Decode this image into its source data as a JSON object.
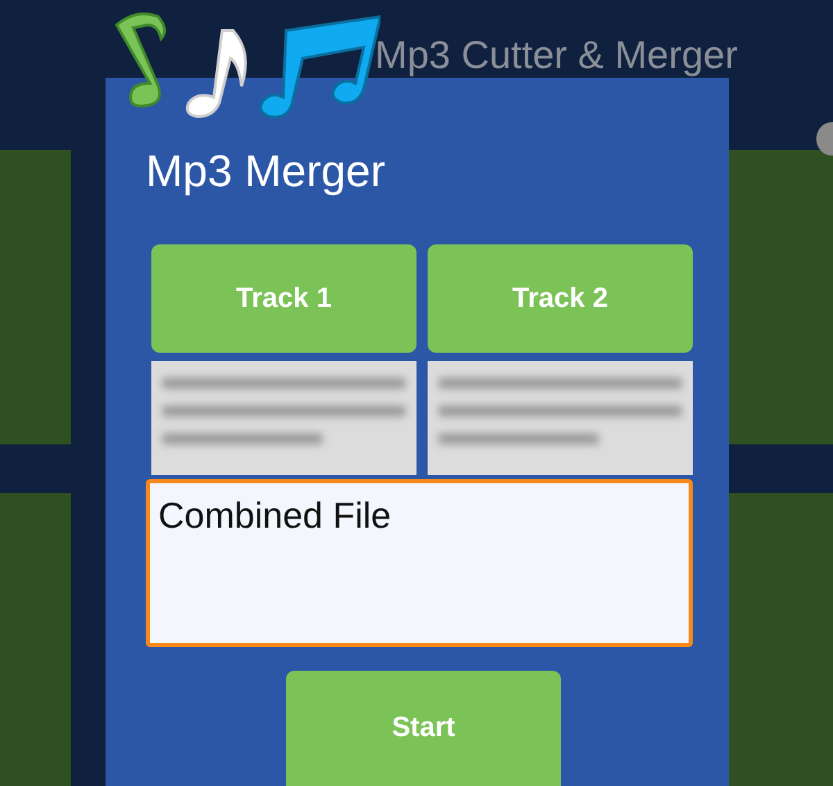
{
  "app_bar": {
    "title": "Mp3 Cutter & Merger"
  },
  "dialog": {
    "title": "Mp3 Merger",
    "tracks": [
      {
        "label": "Track 1"
      },
      {
        "label": "Track 2"
      }
    ],
    "output_field": {
      "value": "Combined File",
      "focused": true
    },
    "start_button": {
      "label": "Start"
    }
  }
}
